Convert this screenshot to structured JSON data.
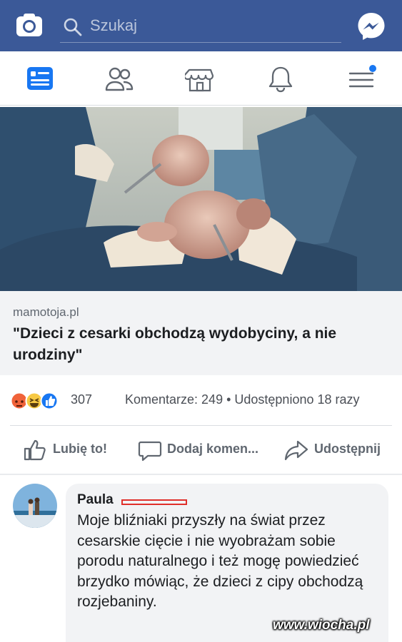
{
  "header": {
    "search_placeholder": "Szukaj",
    "brand_color": "#3b5998",
    "icons": [
      "camera-icon",
      "search-icon",
      "messenger-icon"
    ]
  },
  "nav": {
    "items": [
      {
        "name": "news-feed",
        "icon": "news-feed-icon",
        "active": true
      },
      {
        "name": "friends",
        "icon": "friends-icon"
      },
      {
        "name": "marketplace",
        "icon": "marketplace-icon"
      },
      {
        "name": "notifications",
        "icon": "bell-icon"
      },
      {
        "name": "menu",
        "icon": "hamburger-menu-icon",
        "badge_dot": true
      }
    ],
    "active_color": "#1877f2"
  },
  "post": {
    "link": {
      "domain": "mamotoja.pl",
      "title": "\"Dzieci z cesarki obchodzą wydobyciny, a nie urodziny\""
    },
    "reactions": {
      "types": [
        "angry",
        "haha",
        "like"
      ],
      "count": "307"
    },
    "stats_right": "Komentarze: 249 • Udostępniono 18 razy",
    "actions": {
      "like": "Lubię to!",
      "comment": "Dodaj komen...",
      "share": "Udostępnij"
    }
  },
  "comment": {
    "author": "Paula",
    "text": "Moje bliźniaki przyszły na świat przez cesarskie cięcie i nie wyobrażam sobie porodu naturalnego i też mogę powiedzieć brzydko mówiąc, że dzieci z cipy obchodzą rozjebaniny."
  },
  "watermark": "www.wiocha.pl"
}
